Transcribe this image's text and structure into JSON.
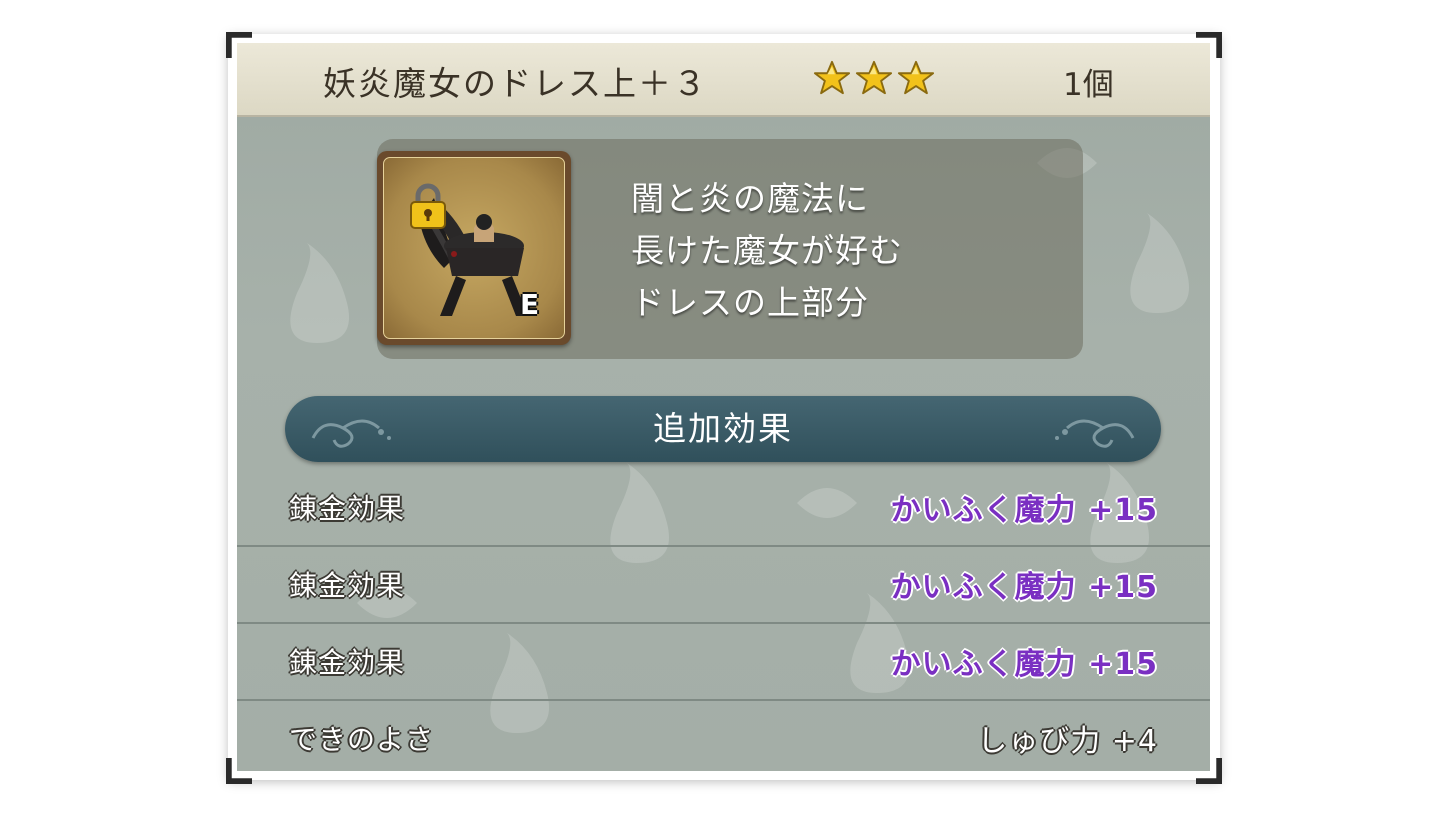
{
  "item": {
    "name": "妖炎魔女のドレス上＋３",
    "rarity_stars": 3,
    "quantity": "1個",
    "equipped_badge": "E",
    "icon": "dress-top-icon",
    "locked_icon": "padlock-icon",
    "description": [
      "闇と炎の魔法に",
      "長けた魔女が好む",
      "ドレスの上部分"
    ]
  },
  "section": {
    "title": "追加効果"
  },
  "effects": [
    {
      "label": "錬金効果",
      "value": "かいふく魔力 +15",
      "color": "#7a2fc2"
    },
    {
      "label": "錬金効果",
      "value": "かいふく魔力 +15",
      "color": "#7a2fc2"
    },
    {
      "label": "錬金効果",
      "value": "かいふく魔力 +15",
      "color": "#7a2fc2"
    },
    {
      "label": "できのよさ",
      "value": "しゅび力 +4",
      "color": "#ffffff"
    }
  ],
  "colors": {
    "star": "#f2c21a",
    "header_bar": "#3a5a66",
    "panel": "#a4aea7",
    "title_bar": "#e4e0cc"
  }
}
